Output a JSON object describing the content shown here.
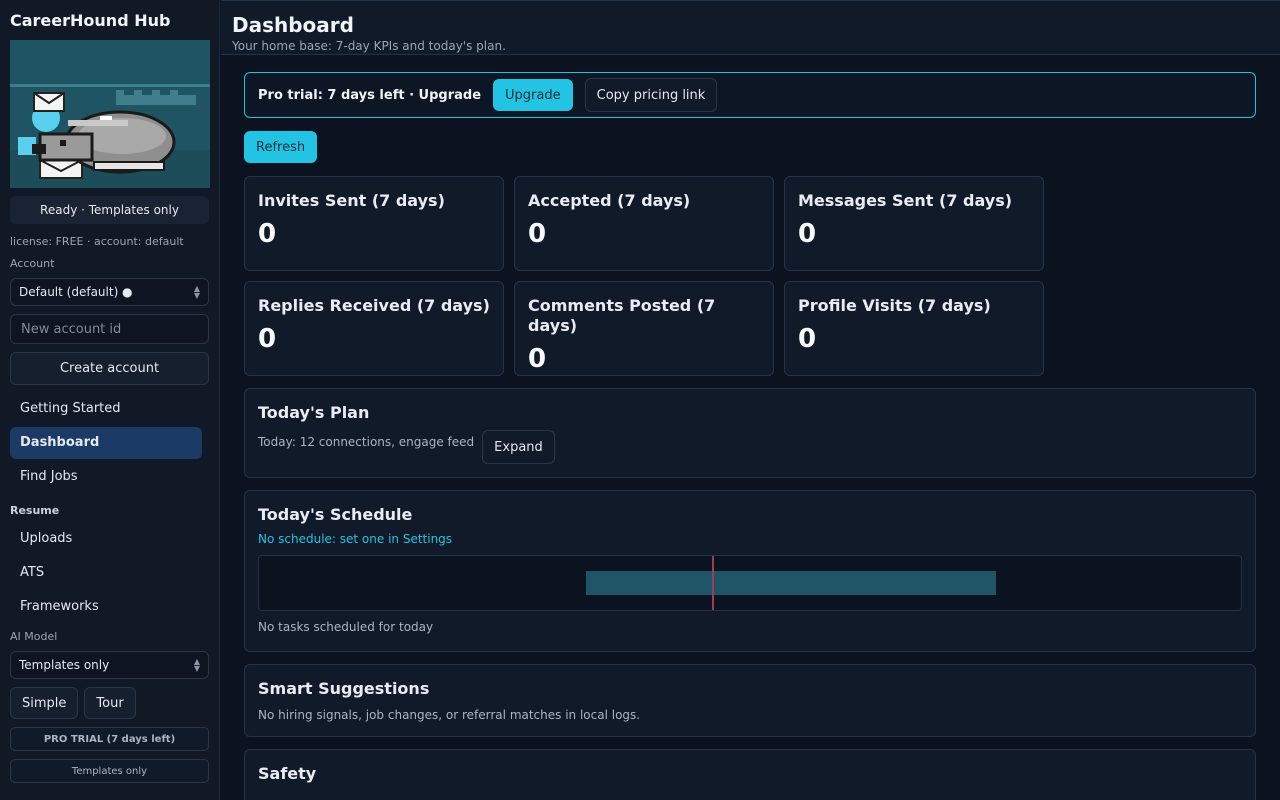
{
  "sidebar": {
    "app_title": "CareerHound Hub",
    "status": "Ready · Templates only",
    "license_line": "license: FREE · account: default",
    "account_label": "Account",
    "account_select": "Default (default) ●",
    "new_account_placeholder": "New account id",
    "create_account": "Create account",
    "nav_top": [
      {
        "label": "Getting Started"
      },
      {
        "label": "Dashboard",
        "active": true
      },
      {
        "label": "Find Jobs"
      }
    ],
    "resume_label": "Resume",
    "nav_resume": [
      {
        "label": "Uploads"
      },
      {
        "label": "ATS"
      },
      {
        "label": "Frameworks"
      }
    ],
    "ai_model_label": "AI Model",
    "ai_model_select": "Templates only",
    "simple_button": "Simple",
    "tour_button": "Tour",
    "trial_badge": "PRO TRIAL (7 days left)",
    "mode_badge": "Templates only"
  },
  "header": {
    "title": "Dashboard",
    "subtitle": "Your home base: 7-day KPIs and today's plan."
  },
  "banner": {
    "text": "Pro trial: 7 days left · Upgrade",
    "upgrade_button": "Upgrade",
    "copy_button": "Copy pricing link"
  },
  "refresh_button": "Refresh",
  "kpis": [
    {
      "label": "Invites Sent (7 days)",
      "value": "0"
    },
    {
      "label": "Accepted (7 days)",
      "value": "0"
    },
    {
      "label": "Messages Sent (7 days)",
      "value": "0"
    },
    {
      "label": "Replies Received (7 days)",
      "value": "0"
    },
    {
      "label": "Comments Posted (7 days)",
      "value": "0"
    },
    {
      "label": "Profile Visits (7 days)",
      "value": "0"
    }
  ],
  "plan": {
    "title": "Today's Plan",
    "text": "Today: 12 connections, engage feed",
    "expand_button": "Expand"
  },
  "schedule": {
    "title": "Today's Schedule",
    "link": "No schedule: set one in Settings",
    "empty_text": "No tasks scheduled for today"
  },
  "suggestions": {
    "title": "Smart Suggestions",
    "text": "No hiring signals, job changes, or referral matches in local logs."
  },
  "safety": {
    "title": "Safety"
  },
  "colors": {
    "accent": "#22c3e3",
    "active_nav": "#1b3a66",
    "background": "#0b1220"
  }
}
